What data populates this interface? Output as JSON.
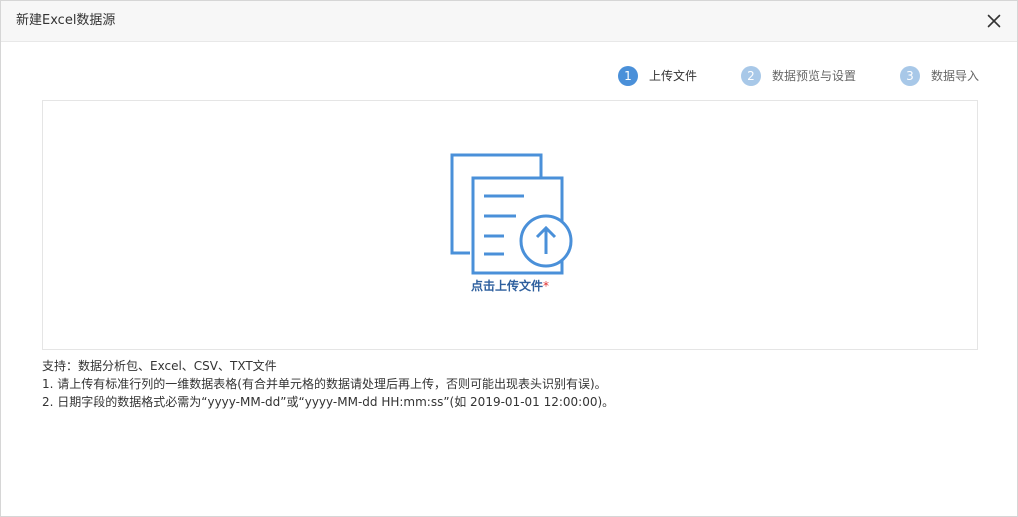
{
  "dialog": {
    "title": "新建Excel数据源"
  },
  "icons": {
    "close": "close-icon",
    "upload": "file-upload-icon"
  },
  "colors": {
    "step_active": "#4a90d9",
    "step_inactive": "#a8c8e8",
    "step_label_active": "#333333",
    "step_label_inactive": "#666666",
    "upload_icon": "#4a90d9",
    "upload_text": "#2e5f9e",
    "required": "#e03030"
  },
  "steps": [
    {
      "number": "1",
      "label": "上传文件",
      "active": true
    },
    {
      "number": "2",
      "label": "数据预览与设置",
      "active": false
    },
    {
      "number": "3",
      "label": "数据导入",
      "active": false
    }
  ],
  "upload": {
    "label": "点击上传文件",
    "required_mark": "*"
  },
  "notes": {
    "supported": "支持：数据分析包、Excel、CSV、TXT文件",
    "rule_1": "1. 请上传有标准行列的一维数据表格(有合并单元格的数据请处理后再上传，否则可能出现表头识别有误)。",
    "rule_2": "2. 日期字段的数据格式必需为“yyyy-MM-dd”或“yyyy-MM-dd HH:mm:ss”(如 2019-01-01 12:00:00)。"
  }
}
